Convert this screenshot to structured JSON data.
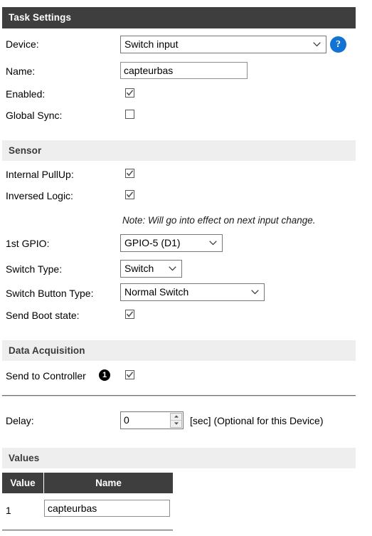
{
  "sections": {
    "task_settings": {
      "title": "Task Settings",
      "device_label": "Device:",
      "device_value": "Switch input",
      "help_glyph": "?",
      "name_label": "Name:",
      "name_value": "capteurbas",
      "name_placeholder": "",
      "enabled_label": "Enabled:",
      "enabled_checked": true,
      "global_sync_label": "Global Sync:",
      "global_sync_checked": false
    },
    "sensor": {
      "title": "Sensor",
      "internal_pullup_label": "Internal PullUp:",
      "internal_pullup_checked": true,
      "inversed_logic_label": "Inversed Logic:",
      "inversed_logic_checked": true,
      "note": "Note: Will go into effect on next input change.",
      "first_gpio_label": "1st GPIO:",
      "first_gpio_value": "GPIO-5 (D1)",
      "switch_type_label": "Switch Type:",
      "switch_type_value": "Switch",
      "switch_button_type_label": "Switch Button Type:",
      "switch_button_type_value": "Normal Switch",
      "send_boot_state_label": "Send Boot state:",
      "send_boot_state_checked": true
    },
    "data_acquisition": {
      "title": "Data Acquisition",
      "send_to_controller_label": "Send to Controller",
      "send_to_controller_badge": "1",
      "send_to_controller_checked": true,
      "delay_label": "Delay:",
      "delay_value": "0",
      "delay_suffix": "[sec] (Optional for this Device)"
    },
    "values": {
      "title": "Values",
      "columns": [
        "Value",
        "Name"
      ],
      "rows": [
        {
          "value": "1",
          "name": "capteurbas"
        }
      ]
    }
  },
  "colors": {
    "header_dark": "#3e3e3e",
    "header_light": "#eeeeee",
    "help_blue": "#1273d4",
    "badge_black": "#000000"
  }
}
